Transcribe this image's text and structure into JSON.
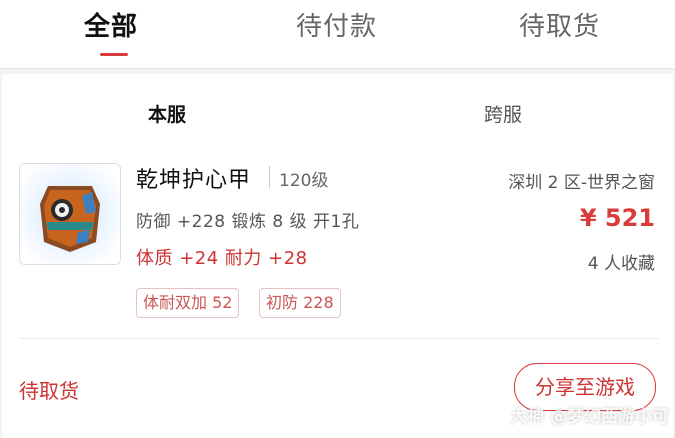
{
  "tabs": {
    "all": "全部",
    "pending_payment": "待付款",
    "pending_pickup": "待取货"
  },
  "subtabs": {
    "local": "本服",
    "cross": "跨服"
  },
  "item": {
    "name": "乾坤护心甲",
    "level": "120级",
    "stats": "防御 +228 锻炼 8 级 开1孔",
    "attrs": "体质 +24 耐力 +28",
    "tags": [
      "体耐双加 52",
      "初防 228"
    ],
    "server": "深圳 2 区-世界之窗",
    "price": "¥ 521",
    "favorites": "4 人收藏",
    "status": "待取货",
    "share_label": "分享至游戏"
  },
  "watermark": "大神 @梦幻西游小可",
  "colors": {
    "accent": "#d93b3b"
  }
}
